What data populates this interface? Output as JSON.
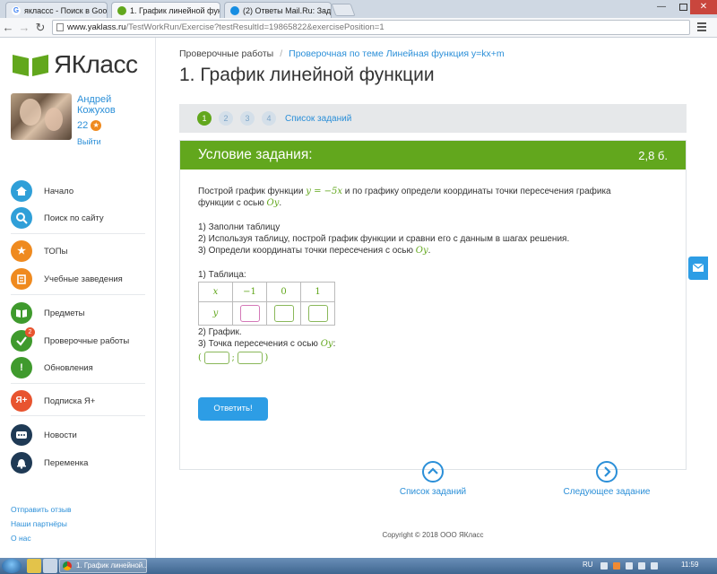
{
  "browser": {
    "tabs": [
      {
        "title": "яклассс - Поиск в Google",
        "favicon": "google-icon",
        "active": false
      },
      {
        "title": "1. График линейной функ",
        "favicon": "yaklass-icon",
        "active": true
      },
      {
        "title": "(2) Ответы Mail.Ru: Зада",
        "favicon": "mailru-icon",
        "active": false
      }
    ],
    "close_glyph": "×",
    "url_host": "www.yaklass.ru",
    "url_path": "/TestWorkRun/Exercise?testResultId=19865822&exercisePosition=1",
    "window_minimize": "—",
    "window_close": "✕"
  },
  "sidebar": {
    "logo_text": "ЯКласс",
    "user": {
      "name": "Андрей Кожухов",
      "points": "22",
      "logout": "Выйти"
    },
    "menu": [
      {
        "label": "Начало",
        "icon": "home-icon",
        "color": "#2f9fd8"
      },
      {
        "label": "Поиск по сайту",
        "icon": "search-icon",
        "color": "#2f9fd8"
      },
      {
        "label": "ТОПы",
        "icon": "star-icon",
        "color": "#ef8a1f"
      },
      {
        "label": "Учебные заведения",
        "icon": "school-icon",
        "color": "#ef8a1f"
      },
      {
        "label": "Предметы",
        "icon": "book-icon",
        "color": "#3f9a2d"
      },
      {
        "label": "Проверочные работы",
        "icon": "check-icon",
        "color": "#3f9a2d",
        "badge": "2"
      },
      {
        "label": "Обновления",
        "icon": "exclamation-icon",
        "color": "#3f9a2d"
      },
      {
        "label": "Подписка Я+",
        "icon": "ya-plus-icon",
        "color": "#e8542f"
      },
      {
        "label": "Новости",
        "icon": "news-icon",
        "color": "#1f3a55"
      },
      {
        "label": "Переменка",
        "icon": "bell-icon",
        "color": "#1f3a55"
      }
    ],
    "footer_links": [
      "Отправить отзыв",
      "Наши партнёры",
      "О нас"
    ]
  },
  "main": {
    "breadcrumb": [
      "Проверочные работы",
      "Проверочная по теме Линейная функция y=kx+m"
    ],
    "breadcrumb_sep": "/",
    "title": "1. График линейной функции",
    "steps": [
      "1",
      "2",
      "3",
      "4"
    ],
    "current_step": "1",
    "task_list_link": "Список заданий",
    "task": {
      "header": "Условие задания:",
      "score": "2,8 б.",
      "intro_before": "Построй график функции ",
      "intro_formula": "y = −5x",
      "intro_after": " и по графику определи координаты точки пересечения графика функции с осью ",
      "axis": "Oy",
      "period": ".",
      "steps": [
        "1) Заполни таблицу",
        "2) Используя таблицу, построй график функции и сравни его с данным в шагах решения.",
        "3) Определи координаты точки пересечения с осью "
      ],
      "table_label": "1) Таблица:",
      "table": {
        "x_label": "x",
        "y_label": "y",
        "x_values": [
          "−1",
          "0",
          "1"
        ]
      },
      "graph_label": "2) График.",
      "point_label": "3) Точка пересечения с осью ",
      "point_colon": ":",
      "paren_open": "(",
      "semicolon": ";",
      "paren_close": ")",
      "submit": "Ответить!"
    },
    "bottom_nav": {
      "tasks": "Список заданий",
      "next": "Следующее задание"
    },
    "copyright": "Copyright © 2018 ООО ЯКласс"
  },
  "taskbar": {
    "app_title": "1. График линейной...",
    "lang": "RU",
    "time": "11:59"
  }
}
